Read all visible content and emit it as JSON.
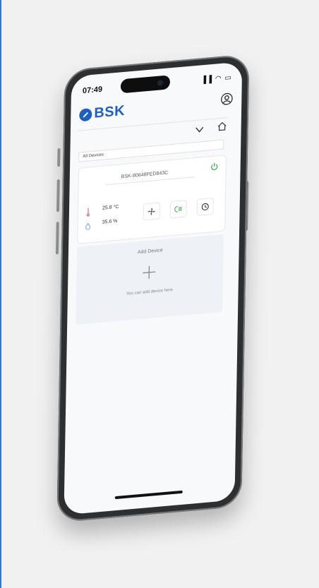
{
  "status": {
    "time": "07:49",
    "icons": "▐▐ ◠ ▭"
  },
  "brand": {
    "name": "BSK",
    "color": "#1f5fc0"
  },
  "filter": {
    "label": "All Devices"
  },
  "device": {
    "name": "BSK-80648FED843C",
    "temperature": "25.8 °C",
    "humidity": "35.6 %",
    "power_color": "#3aa64a"
  },
  "add_device": {
    "title": "Add Device",
    "hint": "You can add device here"
  },
  "icons": {
    "user": "user-circle-icon",
    "chevron": "chevron-down-icon",
    "home": "home-icon",
    "power": "power-icon",
    "thermometer": "thermometer-icon",
    "droplet": "droplet-icon",
    "fan": "fan-icon",
    "mode": "mode-icon",
    "timer": "timer-icon",
    "plus": "plus-icon"
  }
}
